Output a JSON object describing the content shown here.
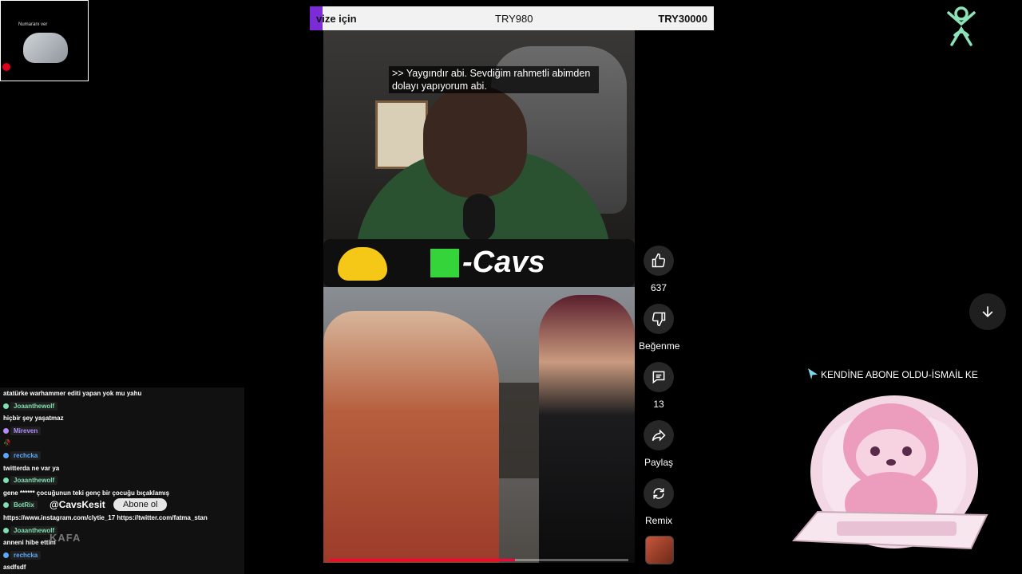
{
  "webcam": {
    "caption": "Numaranı ver"
  },
  "donation_bar": {
    "message": "vize için",
    "amount": "TRY980",
    "goal": "TRY30000",
    "accent_color": "#7b2cd6"
  },
  "video": {
    "caption_line1": ">> Yaygındır abi. Sevdiğim rahmetli abimden",
    "caption_line2": "dolayı yapıyorum abi.",
    "brand_text": "-Cavs",
    "progress": 0.62
  },
  "actions": {
    "like_count": "637",
    "dislike_label": "Beğenme",
    "comment_count": "13",
    "share_label": "Paylaş",
    "remix_label": "Remix"
  },
  "alert": {
    "text": "KENDİNE ABONE OLDU-İSMAİL KE"
  },
  "chat": {
    "overlay_handle": "@CavsKesit",
    "overlay_button": "Abone ol",
    "overlay_watermark": "KAFA",
    "messages": [
      {
        "user": "",
        "text": "atatürke warhammer editi yapan yok mu yahu",
        "color": ""
      },
      {
        "user": "Joaanthewolf",
        "text": "",
        "color": "#7ee0b0"
      },
      {
        "user": "",
        "text": "hiçbir şey yaşatmaz",
        "color": ""
      },
      {
        "user": "Mireven",
        "text": "",
        "color": "#b48cff"
      },
      {
        "user": "",
        "text": "🥀",
        "color": ""
      },
      {
        "user": "rechcka",
        "text": "",
        "color": "#5aa9ff"
      },
      {
        "user": "",
        "text": "twitterda ne var ya",
        "color": ""
      },
      {
        "user": "Joaanthewolf",
        "text": "",
        "color": "#7ee0b0"
      },
      {
        "user": "",
        "text": "gene ****** çocuğunun teki genç bir çocuğu bıçaklamış",
        "color": ""
      },
      {
        "user": "BotRix",
        "text": "",
        "color": "#7ee0b0"
      },
      {
        "user": "",
        "text": "https://www.instagram.com/clytie_17 https://twitter.com/fatma_stan",
        "color": ""
      },
      {
        "user": "Joaanthewolf",
        "text": "",
        "color": "#7ee0b0"
      },
      {
        "user": "",
        "text": "anneni hibe ettim",
        "color": ""
      },
      {
        "user": "rechcka",
        "text": "",
        "color": "#5aa9ff"
      },
      {
        "user": "",
        "text": "asdfsdf",
        "color": ""
      }
    ]
  }
}
